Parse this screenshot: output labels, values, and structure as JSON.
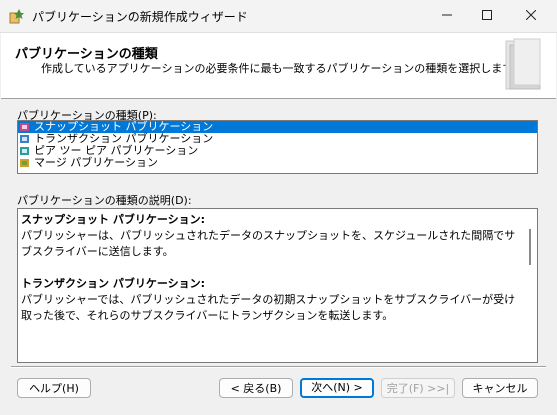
{
  "window": {
    "title": "パブリケーションの新規作成ウィザード"
  },
  "banner": {
    "title": "パブリケーションの種類",
    "description": "作成しているアプリケーションの必要条件に最も一致するパブリケーションの種類を選択します。"
  },
  "types_section": {
    "label": "パブリケーションの種類(P):",
    "items": [
      {
        "label": "スナップショット パブリケーション",
        "icon": "snapshot-icon",
        "selected": true
      },
      {
        "label": "トランザクション パブリケーション",
        "icon": "transaction-icon",
        "selected": false
      },
      {
        "label": "ピア ツー ピア パブリケーション",
        "icon": "peer-to-peer-icon",
        "selected": false
      },
      {
        "label": "マージ パブリケーション",
        "icon": "merge-icon",
        "selected": false
      }
    ]
  },
  "description_section": {
    "label": "パブリケーションの種類の説明(D):",
    "entries": [
      {
        "heading": "スナップショット パブリケーション:",
        "text": "パブリッシャーは、パブリッシュされたデータのスナップショットを、スケジュールされた間隔でサブスクライバーに送信します。"
      },
      {
        "heading": "トランザクション パブリケーション:",
        "text": "パブリッシャーでは、パブリッシュされたデータの初期スナップショットをサブスクライバーが受け取った後で、それらのサブスクライバーにトランザクションを転送します。"
      }
    ]
  },
  "buttons": {
    "help": "ヘルプ(H)",
    "back": "< 戻る(B)",
    "next": "次へ(N) >",
    "finish": "完了(F) >>|",
    "cancel": "キャンセル"
  },
  "colors": {
    "selection": "#0078d7"
  }
}
